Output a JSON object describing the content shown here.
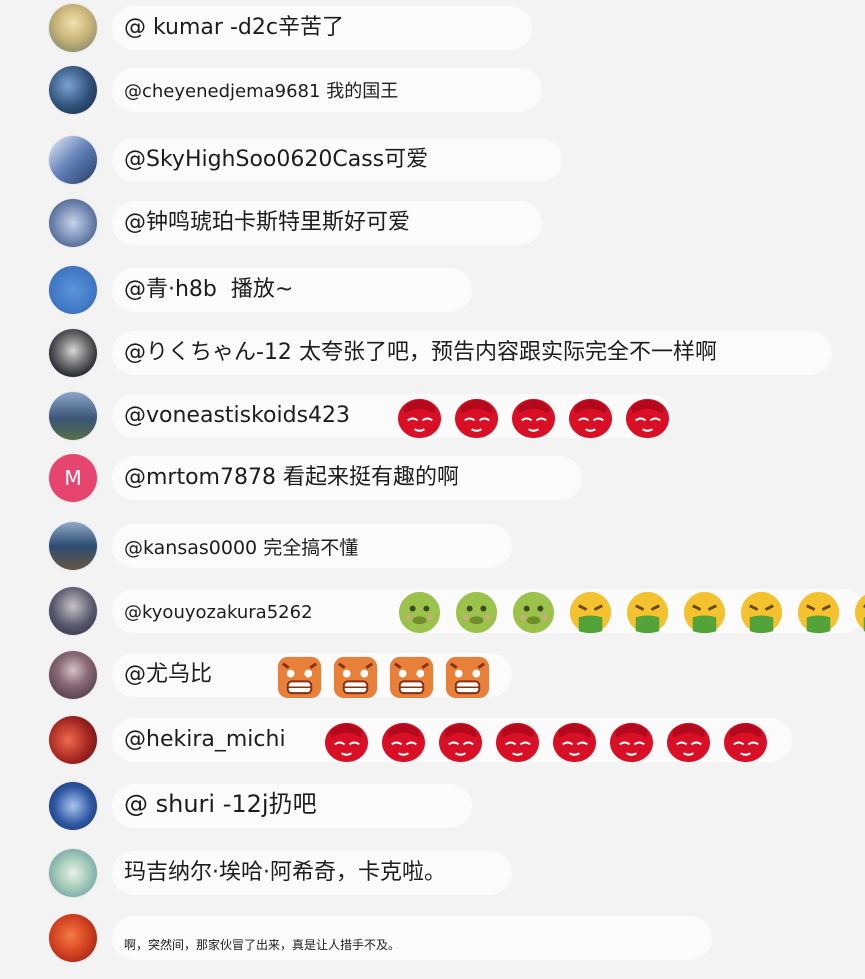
{
  "comments": [
    {
      "user": "@ kumar",
      "text": "-d2c辛苦了",
      "avatar_color": "#c9b57a"
    },
    {
      "user": "@cheyenedjema9681",
      "text": "我的国王",
      "avatar_color": "#2e4f77"
    },
    {
      "user": "@SkyHighSoo0620Cass",
      "text": "可爱",
      "avatar_color": "#5f7fb6"
    },
    {
      "user": "@钟鸣琥珀卡斯特里斯",
      "text": "好可爱",
      "avatar_color": "#6f86b1"
    },
    {
      "user": "@青·h8b",
      "text": "播放~",
      "avatar_color": "#3f77c4"
    },
    {
      "user": "@りくちゃん-12",
      "text": "太夸张了吧，预告内容跟实际完全不一样啊",
      "avatar_color": "#2c2f35"
    },
    {
      "user": "@voneastiskoids423",
      "text": "",
      "avatar_color": "#3b5478",
      "emoji": "red-sleepy",
      "emoji_count": 5
    },
    {
      "user": "@mrtom7878",
      "text": "看起来挺有趣的啊",
      "avatar_color": "#e6456f",
      "avatar_letter": "M"
    },
    {
      "user": "@kansas0000",
      "text": "完全搞不懂",
      "avatar_color": "#2d4c73"
    },
    {
      "user": "@kyouyozakura5262",
      "text": "",
      "avatar_color": "#55566a",
      "emoji": "mixed-sick",
      "emoji_count": 9
    },
    {
      "user": "@尤乌比",
      "text": "",
      "avatar_color": "#5a3b4b",
      "emoji": "orange-shock",
      "emoji_count": 4
    },
    {
      "user": "@hekira_michi",
      "text": "",
      "avatar_color": "#a42620",
      "emoji": "red-sleepy",
      "emoji_count": 8
    },
    {
      "user": "@ shuri",
      "text": "-12j扔吧",
      "avatar_color": "#2f57a2"
    },
    {
      "user": "",
      "text": "玛吉纳尔·埃哈·阿希奇，卡克啦。",
      "avatar_color": "#9dc7b5"
    },
    {
      "user": "",
      "text": "啊，突然间，那家伙冒了出来，真是让人措手不及。",
      "avatar_color": "#d3401f"
    }
  ]
}
